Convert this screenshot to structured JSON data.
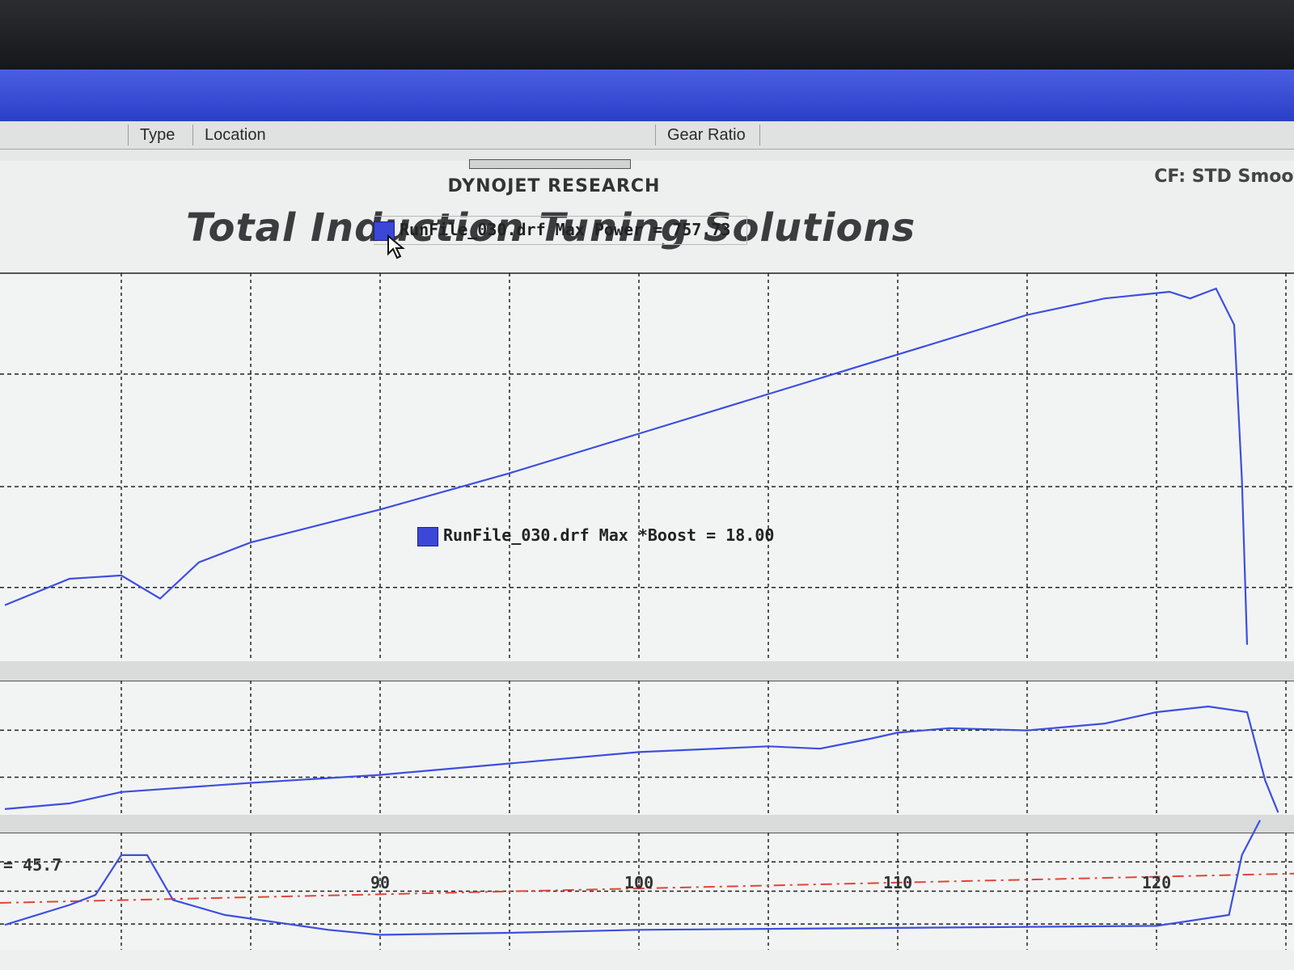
{
  "table_header": {
    "columns": [
      "Type",
      "Location",
      "Gear Ratio"
    ]
  },
  "report": {
    "company": "DYNOJET RESEARCH",
    "title": "Total Induction Tuning Solutions",
    "correction": "CF: STD  Smoot"
  },
  "legends": {
    "power": "RunFile_030.drf Max Power = 757.73",
    "boost": "RunFile_030.drf Max *Boost = 18.00"
  },
  "readout": "= 45.7",
  "colors": {
    "trace": "#3d4fe0",
    "afr_target": "#e0453a",
    "swatch": "#3b47d6"
  },
  "icons": {
    "cursor": "arrow-cursor-icon"
  },
  "chart_data": {
    "type": "line",
    "x_axis": {
      "ticks": [
        90,
        100,
        110,
        120
      ],
      "range": [
        75,
        125
      ]
    },
    "series": [
      {
        "name": "RunFile_030.drf",
        "panel": "power",
        "points": [
          [
            75.5,
            0.17
          ],
          [
            78,
            0.25
          ],
          [
            80,
            0.26
          ],
          [
            81.5,
            0.19
          ],
          [
            83,
            0.3
          ],
          [
            85,
            0.36
          ],
          [
            90,
            0.46
          ],
          [
            95,
            0.57
          ],
          [
            100,
            0.69
          ],
          [
            105,
            0.81
          ],
          [
            110,
            0.93
          ],
          [
            115,
            1.05
          ],
          [
            118,
            1.1
          ],
          [
            120.5,
            1.12
          ],
          [
            121.3,
            1.1
          ],
          [
            122.3,
            1.13
          ],
          [
            123,
            1.02
          ],
          [
            123.3,
            0.55
          ],
          [
            123.5,
            0.05
          ]
        ]
      },
      {
        "name": "RunFile_030.drf",
        "panel": "boost",
        "points": [
          [
            75.5,
            0.05
          ],
          [
            78,
            0.1
          ],
          [
            80,
            0.2
          ],
          [
            85,
            0.28
          ],
          [
            90,
            0.35
          ],
          [
            95,
            0.45
          ],
          [
            100,
            0.55
          ],
          [
            105,
            0.6
          ],
          [
            107,
            0.58
          ],
          [
            109,
            0.67
          ],
          [
            110,
            0.72
          ],
          [
            112,
            0.76
          ],
          [
            115,
            0.74
          ],
          [
            118,
            0.8
          ],
          [
            120,
            0.9
          ],
          [
            122,
            0.95
          ],
          [
            123.5,
            0.9
          ],
          [
            124.2,
            0.3
          ],
          [
            124.7,
            0.02
          ]
        ]
      },
      {
        "name": "RunFile_030.drf",
        "panel": "afr",
        "points": [
          [
            75.5,
            0.25
          ],
          [
            78,
            0.45
          ],
          [
            79,
            0.55
          ],
          [
            80,
            0.95
          ],
          [
            81,
            0.95
          ],
          [
            82,
            0.5
          ],
          [
            84,
            0.35
          ],
          [
            88,
            0.2
          ],
          [
            90,
            0.15
          ],
          [
            95,
            0.17
          ],
          [
            100,
            0.2
          ],
          [
            110,
            0.22
          ],
          [
            120,
            0.24
          ],
          [
            122.8,
            0.35
          ],
          [
            123.3,
            0.95
          ],
          [
            124,
            1.3
          ]
        ]
      }
    ]
  }
}
